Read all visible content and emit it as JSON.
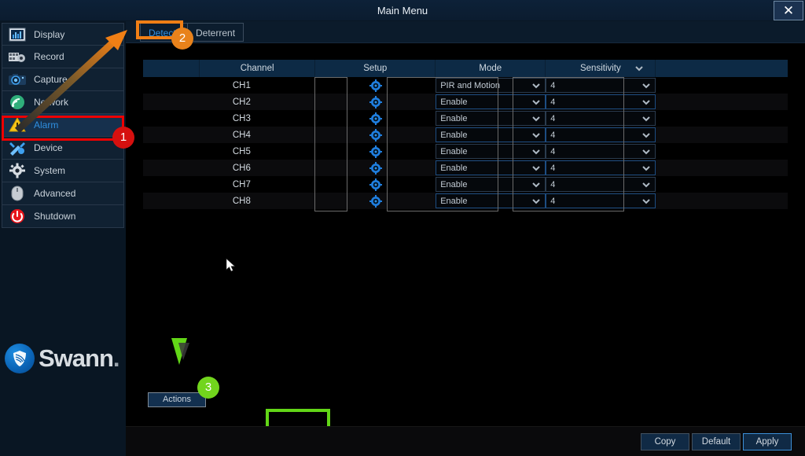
{
  "window": {
    "title": "Main Menu",
    "close_icon": "close-icon",
    "close_label": "✕"
  },
  "sidebar": {
    "items": [
      {
        "label": "Display",
        "icon": "display-icon",
        "active": false
      },
      {
        "label": "Record",
        "icon": "record-icon",
        "active": false
      },
      {
        "label": "Capture",
        "icon": "capture-icon",
        "active": false
      },
      {
        "label": "Network",
        "icon": "network-icon",
        "active": false
      },
      {
        "label": "Alarm",
        "icon": "alarm-icon",
        "active": true
      },
      {
        "label": "Device",
        "icon": "device-icon",
        "active": false
      },
      {
        "label": "System",
        "icon": "system-icon",
        "active": false
      },
      {
        "label": "Advanced",
        "icon": "advanced-icon",
        "active": false
      },
      {
        "label": "Shutdown",
        "icon": "shutdown-icon",
        "active": false
      }
    ],
    "brand": {
      "name": "Swann",
      "suffix": "."
    }
  },
  "tabs": [
    {
      "label": "Detection",
      "active": true
    },
    {
      "label": "Deterrent",
      "active": false
    }
  ],
  "table": {
    "headers": [
      "",
      "Channel",
      "Setup",
      "Mode",
      "Sensitivity",
      ""
    ],
    "sensitivity_header_caret": "chevron-down-icon",
    "rows": [
      {
        "channel": "CH1",
        "setup": "gear-icon",
        "mode": "PIR and Motion",
        "sensitivity": "4"
      },
      {
        "channel": "CH2",
        "setup": "gear-icon",
        "mode": "Enable",
        "sensitivity": "4"
      },
      {
        "channel": "CH3",
        "setup": "gear-icon",
        "mode": "Enable",
        "sensitivity": "4"
      },
      {
        "channel": "CH4",
        "setup": "gear-icon",
        "mode": "Enable",
        "sensitivity": "4"
      },
      {
        "channel": "CH5",
        "setup": "gear-icon",
        "mode": "Enable",
        "sensitivity": "4"
      },
      {
        "channel": "CH6",
        "setup": "gear-icon",
        "mode": "Enable",
        "sensitivity": "4"
      },
      {
        "channel": "CH7",
        "setup": "gear-icon",
        "mode": "Enable",
        "sensitivity": "4"
      },
      {
        "channel": "CH8",
        "setup": "gear-icon",
        "mode": "Enable",
        "sensitivity": "4"
      }
    ]
  },
  "actions": {
    "label": "Actions"
  },
  "footer": {
    "copy_label": "Copy",
    "default_label": "Default",
    "apply_label": "Apply"
  },
  "annotations": {
    "badge_1": "1",
    "badge_2": "2",
    "badge_3": "3",
    "color_red": "#ee0000",
    "color_orange": "#f07f15",
    "color_green": "#62d617"
  }
}
